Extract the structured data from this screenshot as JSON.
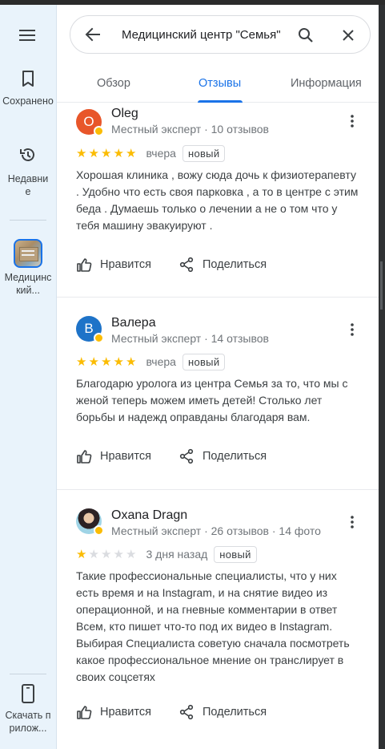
{
  "rail": {
    "saved_label": "Сохранено",
    "recent_label": "Недавние",
    "place_label": "Медицинский...",
    "download_label": "Скачать прилож..."
  },
  "search": {
    "query": "Медицинский центр \"Семья\""
  },
  "tabs": [
    {
      "label": "Обзор",
      "active": false
    },
    {
      "label": "Отзывы",
      "active": true
    },
    {
      "label": "Информация",
      "active": false
    }
  ],
  "colors": {
    "accent": "#1a73e8",
    "star": "#fbbc04"
  },
  "reviews": [
    {
      "initial": "O",
      "avatar_color": "#e8562a",
      "name": "Oleg",
      "meta": "Местный эксперт · 10 отзывов",
      "rating": 5,
      "date": "вчера",
      "badge": "новый",
      "text": "Хорошая клиника , вожу сюда дочь к физиотерапевту . Удобно что есть своя парковка , а то в центре с этим беда . Думаешь только о лечении а не о том что у тебя машину эвакуируют .",
      "like_label": "Нравится",
      "share_label": "Поделиться"
    },
    {
      "initial": "B",
      "avatar_color": "#1e73c8",
      "name": "Валера",
      "meta": "Местный эксперт · 14 отзывов",
      "rating": 5,
      "date": "вчера",
      "badge": "новый",
      "text": "Благодарю уролога из центра Семья за то, что мы с женой теперь можем иметь детей! Столько лет борьбы и надежд оправданы благодаря вам.",
      "like_label": "Нравится",
      "share_label": "Поделиться"
    },
    {
      "initial": "",
      "avatar_color": "",
      "name": "Oxana Dragn",
      "meta": "Местный эксперт · 26 отзывов · 14 фото",
      "rating": 1,
      "date": "3 дня назад",
      "badge": "новый",
      "text": "Такие профессиональные специалисты, что у них есть время и на Instagram, и на снятие видео из операционной, и на гневные комментарии в ответ Всем, кто пишет что-то под их видео в Instagram. Выбирая Специалиста советую сначала посмотреть какое профессиональное мнение он транслирует в своих соцсетях",
      "like_label": "Нравится",
      "share_label": "Поделиться"
    }
  ]
}
